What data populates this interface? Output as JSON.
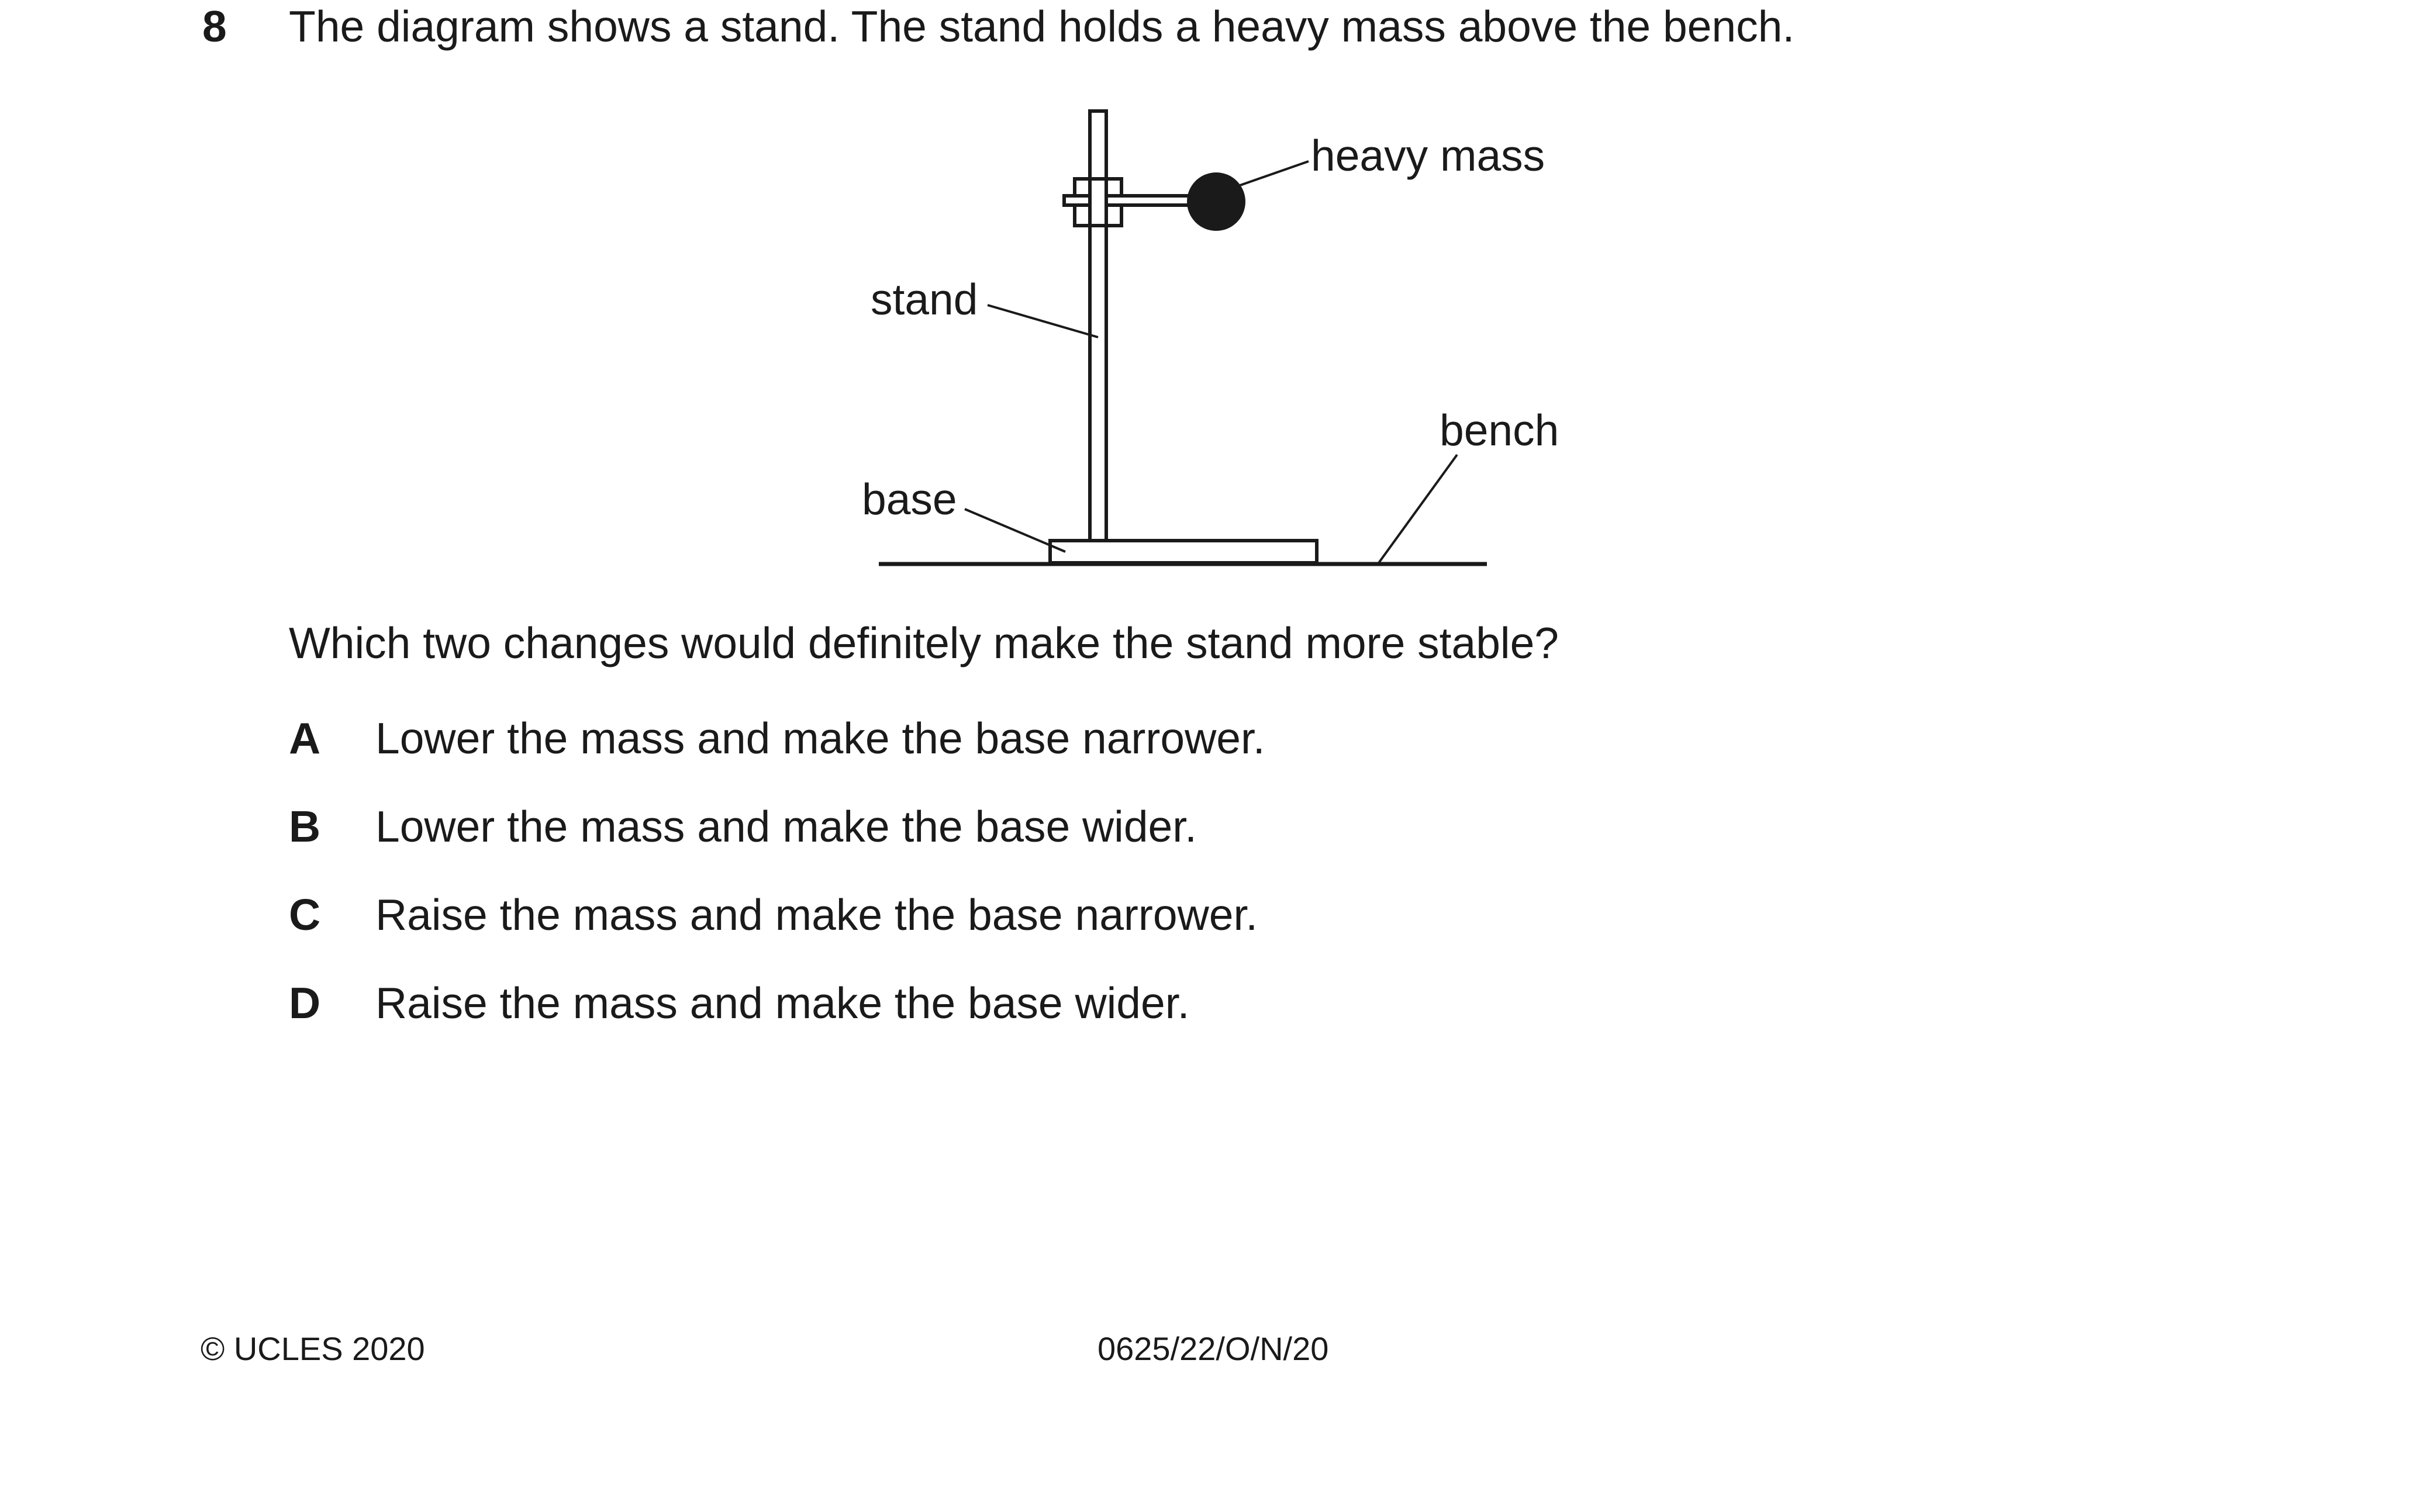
{
  "question": {
    "number": "8",
    "stem": "The diagram shows a stand. The stand holds a heavy mass above the bench."
  },
  "diagram": {
    "labels": {
      "heavy_mass": "heavy mass",
      "stand": "stand",
      "base": "base",
      "bench": "bench"
    }
  },
  "prompt": "Which two changes would definitely make the stand more stable?",
  "options": [
    {
      "letter": "A",
      "text": "Lower the mass and make the base narrower."
    },
    {
      "letter": "B",
      "text": "Lower the mass and make the base wider."
    },
    {
      "letter": "C",
      "text": "Raise the mass and make the base narrower."
    },
    {
      "letter": "D",
      "text": "Raise the mass and make the base wider."
    }
  ],
  "footer": {
    "copyright": "© UCLES 2020",
    "paper_code": "0625/22/O/N/20"
  }
}
